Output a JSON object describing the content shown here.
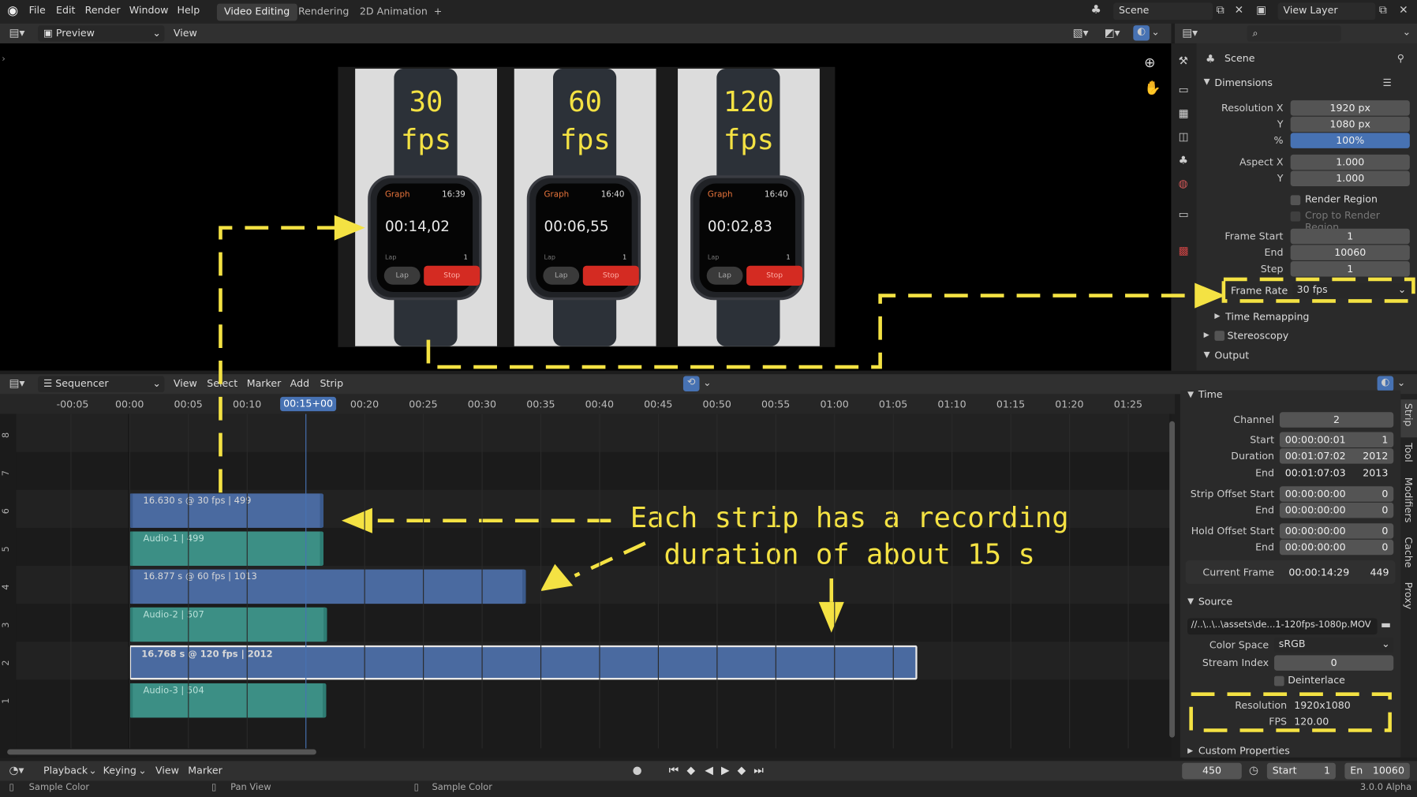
{
  "topbar": {
    "menus": [
      "File",
      "Edit",
      "Render",
      "Window",
      "Help"
    ],
    "workspaces": [
      "Video Editing",
      "Rendering",
      "2D Animation"
    ],
    "add_workspace": "+",
    "scene": "Scene",
    "view_layer": "View Layer"
  },
  "preview_header": {
    "mode": "Preview",
    "view": "View"
  },
  "watches": [
    {
      "fps_line1": "30",
      "fps_line2": "fps",
      "app": "Graph",
      "clock": "16:39",
      "time": "00:14,02",
      "lap_label": "Lap",
      "lap_count": "1",
      "lap_btn": "Lap",
      "stop_btn": "Stop"
    },
    {
      "fps_line1": "60",
      "fps_line2": "fps",
      "app": "Graph",
      "clock": "16:40",
      "time": "00:06,55",
      "lap_label": "Lap",
      "lap_count": "1",
      "lap_btn": "Lap",
      "stop_btn": "Stop"
    },
    {
      "fps_line1": "120",
      "fps_line2": "fps",
      "app": "Graph",
      "clock": "16:40",
      "time": "00:02,83",
      "lap_label": "Lap",
      "lap_count": "1",
      "lap_btn": "Lap",
      "stop_btn": "Stop"
    }
  ],
  "properties": {
    "context": "Scene",
    "dimensions": {
      "title": "Dimensions",
      "resolution_x_label": "Resolution X",
      "resolution_x": "1920 px",
      "y_label": "Y",
      "resolution_y": "1080 px",
      "percent_label": "%",
      "percent": "100%",
      "aspect_x_label": "Aspect X",
      "aspect_x": "1.000",
      "aspect_y_label": "Y",
      "aspect_y": "1.000",
      "render_region": "Render Region",
      "crop": "Crop to Render Region",
      "frame_start_label": "Frame Start",
      "frame_start": "1",
      "end_label": "End",
      "frame_end": "10060",
      "step_label": "Step",
      "step": "1",
      "frame_rate_label": "Frame Rate",
      "frame_rate": "30 fps"
    },
    "time_remapping": "Time Remapping",
    "stereoscopy": "Stereoscopy",
    "output": "Output"
  },
  "sequencer_header": {
    "mode": "Sequencer",
    "menus": [
      "View",
      "Select",
      "Marker",
      "Add",
      "Strip"
    ]
  },
  "timeline": {
    "ticks": [
      "-00:05",
      "00:00",
      "00:05",
      "00:10",
      "00:15+00",
      "00:20",
      "00:25",
      "00:30",
      "00:35",
      "00:40",
      "00:45",
      "00:50",
      "00:55",
      "01:00",
      "01:05",
      "01:10",
      "01:15",
      "01:20",
      "01:25"
    ],
    "current": "00:15+00"
  },
  "channels": [
    "8",
    "7",
    "6",
    "5",
    "4",
    "3",
    "2",
    "1"
  ],
  "strips": [
    {
      "label": "16.630 s @ 30 fps | 499",
      "kind": "video",
      "channel": 6,
      "start": 0,
      "end": 16.6
    },
    {
      "label": "Audio-1 | 499",
      "kind": "audio",
      "channel": 5,
      "start": 0,
      "end": 16.6
    },
    {
      "label": "16.877 s @ 60 fps | 1013",
      "kind": "video",
      "channel": 4,
      "start": 0,
      "end": 33.8
    },
    {
      "label": "Audio-2 | 507",
      "kind": "audio",
      "channel": 3,
      "start": 0,
      "end": 16.9
    },
    {
      "label": "16.768 s @ 120 fps | 2012",
      "kind": "video-selected",
      "channel": 2,
      "start": 0,
      "end": 67.1
    },
    {
      "label": "Audio-3 | 504",
      "kind": "audio",
      "channel": 1,
      "start": 0,
      "end": 16.8
    }
  ],
  "strip_panel": {
    "time_title": "Time",
    "channel_label": "Channel",
    "channel": "2",
    "start_label": "Start",
    "start": "00:00:00:01",
    "start_frame": "1",
    "duration_label": "Duration",
    "duration": "00:01:07:02",
    "duration_frame": "2012",
    "end_label": "End",
    "end": "00:01:07:03",
    "end_frame": "2013",
    "offset_start_label": "Strip Offset Start",
    "offset_start": "00:00:00:00",
    "offset_start_frame": "0",
    "offset_end_label": "End",
    "offset_end": "00:00:00:00",
    "offset_end_frame": "0",
    "hold_start_label": "Hold Offset Start",
    "hold_start": "00:00:00:00",
    "hold_start_frame": "0",
    "hold_end_label": "End",
    "hold_end": "00:00:00:00",
    "hold_end_frame": "0",
    "current_frame_label": "Current Frame",
    "current_frame": "00:00:14:29",
    "current_frame_num": "449",
    "source_title": "Source",
    "file": "//..\\..\\..\\assets\\de...1-120fps-1080p.MOV",
    "color_space_label": "Color Space",
    "color_space": "sRGB",
    "stream_index_label": "Stream Index",
    "stream_index": "0",
    "deinterlace": "Deinterlace",
    "resolution_label": "Resolution",
    "resolution": "1920x1080",
    "fps_label": "FPS",
    "fps": "120.00",
    "custom_props": "Custom Properties",
    "tabs": [
      "Strip",
      "Tool",
      "Modifiers",
      "Cache",
      "Proxy"
    ]
  },
  "annotation": {
    "line1": "Each strip has a recording",
    "line2": "duration of about 15 s"
  },
  "playback": {
    "menus": [
      "Playback",
      "Keying",
      "View",
      "Marker"
    ],
    "frame": "450",
    "start_label": "Start",
    "start": "1",
    "end_label": "En",
    "end": "10060"
  },
  "statusbar": {
    "left": "Sample Color",
    "mid1": "Pan View",
    "mid2": "Sample Color",
    "version": "3.0.0 Alpha"
  },
  "colors": {
    "annotation": "#f4e243",
    "selected_field": "#4772b3",
    "video_strip": "#4a6aa0",
    "audio_strip": "#3c8f85"
  }
}
